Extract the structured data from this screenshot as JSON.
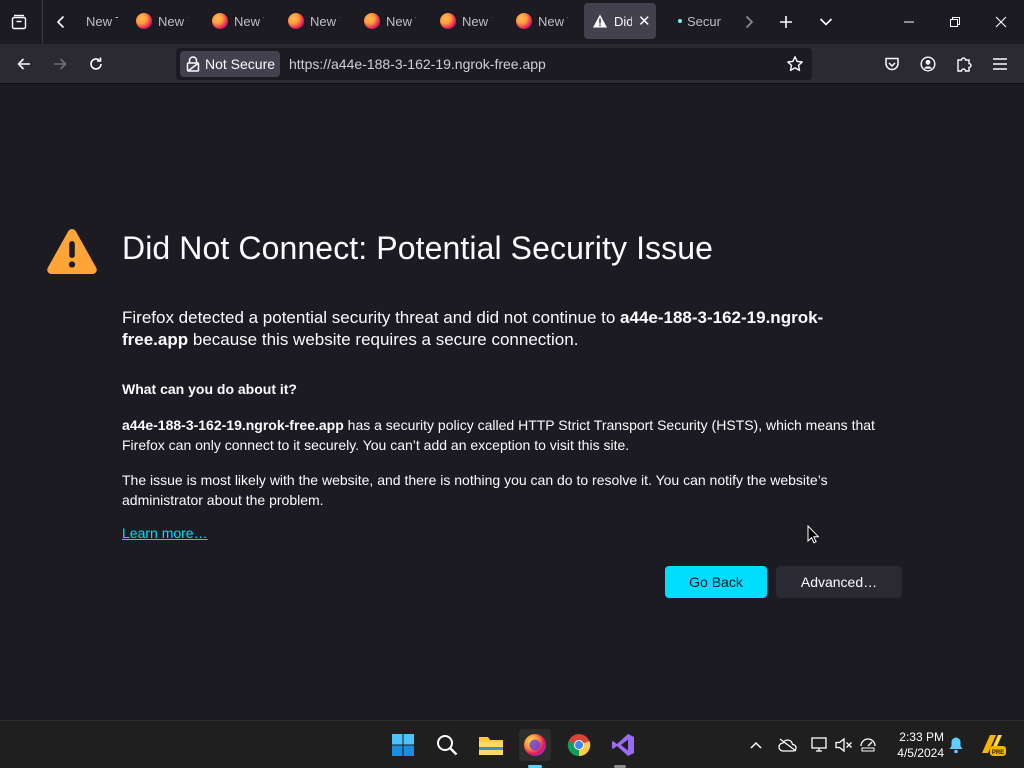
{
  "browser": {
    "tabs": [
      {
        "label": "New Tab"
      },
      {
        "label": "New Tab"
      },
      {
        "label": "New Tab"
      },
      {
        "label": "New Tab"
      },
      {
        "label": "New Tab"
      },
      {
        "label": "New Tab"
      },
      {
        "label": "New Tab"
      },
      {
        "label": "Did Not Connect",
        "active": true
      },
      {
        "label": "Security"
      }
    ],
    "security_label": "Not Secure",
    "url": "https://a44e-188-3-162-19.ngrok-free.app"
  },
  "error_page": {
    "title": "Did Not Connect: Potential Security Issue",
    "intro_before": "Firefox detected a potential security threat and did not continue to ",
    "intro_host": "a44e-188-3-162-19.ngrok-free.app",
    "intro_after": " because this website requires a secure connection.",
    "what_heading": "What can you do about it?",
    "p1_host": "a44e-188-3-162-19.ngrok-free.app",
    "p1_rest": " has a security policy called HTTP Strict Transport Security (HSTS), which means that Firefox can only connect to it securely. You can’t add an exception to visit this site.",
    "p2": "The issue is most likely with the website, and there is nothing you can do to resolve it. You can notify the website’s administrator about the problem.",
    "learn_more": "Learn more…",
    "go_back": "Go Back",
    "advanced": "Advanced…"
  },
  "taskbar": {
    "time": "2:33 PM",
    "date": "4/5/2024"
  },
  "colors": {
    "accent": "#00ddff",
    "background": "#1c1b22",
    "warning": "#ffa436"
  }
}
